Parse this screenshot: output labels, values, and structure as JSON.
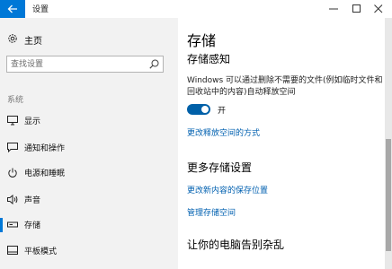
{
  "window": {
    "title": "设置"
  },
  "sidebar": {
    "home_label": "主页",
    "search_placeholder": "查找设置",
    "section_label": "系统",
    "items": [
      {
        "label": "显示",
        "icon": "display-icon"
      },
      {
        "label": "通知和操作",
        "icon": "notification-icon"
      },
      {
        "label": "电源和睡眠",
        "icon": "power-icon"
      },
      {
        "label": "声音",
        "icon": "speaker-icon"
      },
      {
        "label": "存储",
        "icon": "storage-icon",
        "selected": true
      },
      {
        "label": "平板模式",
        "icon": "tablet-icon"
      }
    ]
  },
  "main": {
    "page_title": "存储",
    "storage_sense": {
      "heading": "存储感知",
      "description": "Windows 可以通过删除不需要的文件(例如临时文件和回收站中的内容)自动释放空间",
      "toggle_state": "开",
      "toggle_on": true,
      "link_change_free_space": "更改释放空间的方式"
    },
    "more_settings": {
      "heading": "更多存储设置",
      "link_save_location": "更改新内容的保存位置",
      "link_manage_spaces": "管理存储空间"
    },
    "declutter": {
      "heading": "让你的电脑告别杂乱"
    }
  },
  "colors": {
    "accent": "#0078d7",
    "sidebar_bg": "#f2f2f2",
    "link": "#0060b0"
  }
}
